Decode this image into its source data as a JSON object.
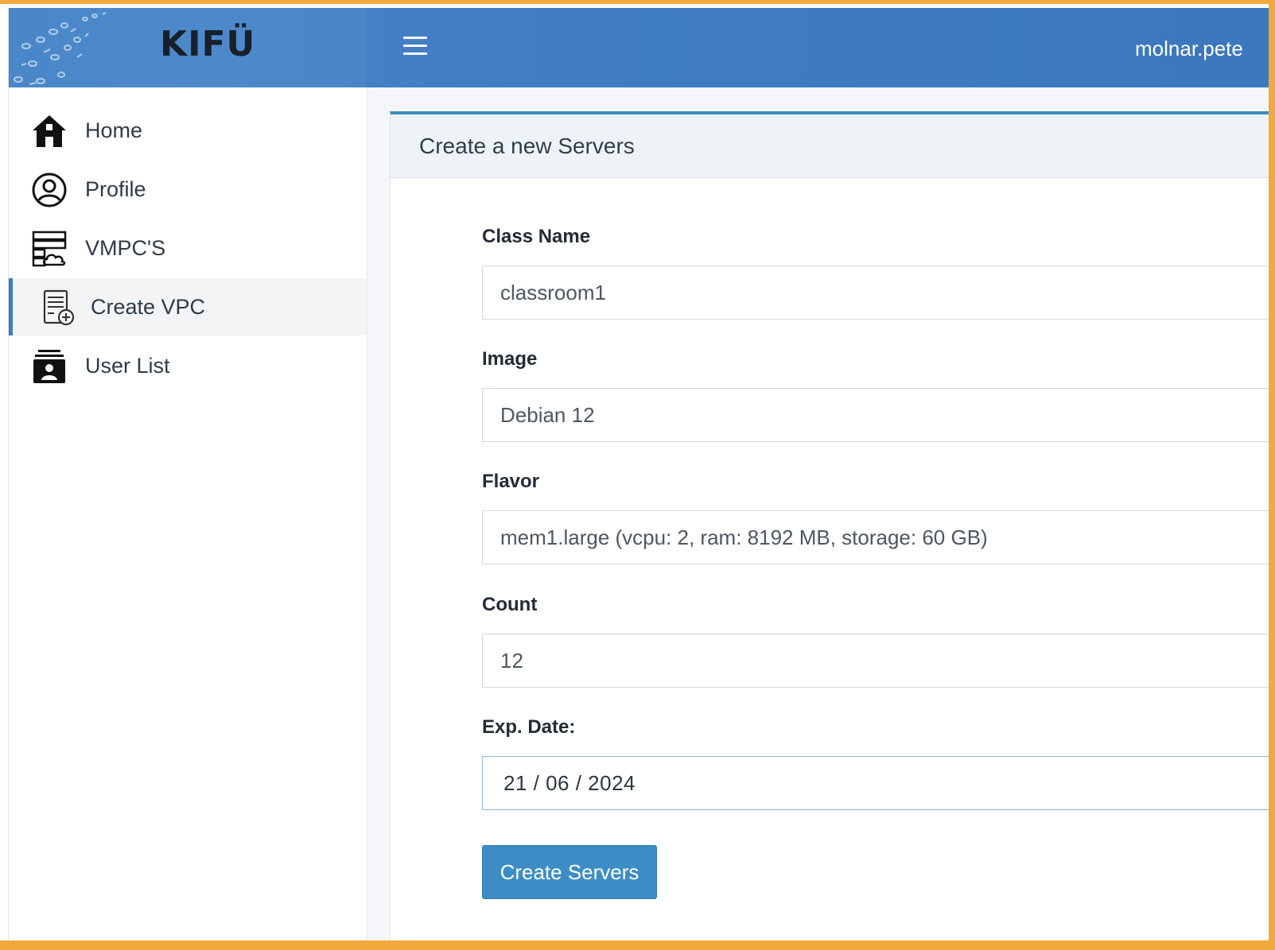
{
  "header": {
    "logo_text": "KIFÜ",
    "username": "molnar.pete"
  },
  "sidebar": {
    "items": [
      {
        "label": "Home",
        "icon": "home-icon"
      },
      {
        "label": "Profile",
        "icon": "user-circle-icon"
      },
      {
        "label": "VMPC'S",
        "icon": "server-cloud-icon"
      },
      {
        "label": "Create VPC",
        "icon": "server-add-icon",
        "active": true
      },
      {
        "label": "User List",
        "icon": "user-list-icon"
      }
    ]
  },
  "card": {
    "title": "Create a new Servers"
  },
  "form": {
    "class_name": {
      "label": "Class Name",
      "value": "classroom1"
    },
    "image": {
      "label": "Image",
      "value": "Debian 12"
    },
    "flavor": {
      "label": "Flavor",
      "value": "mem1.large (vcpu: 2, ram: 8192 MB, storage: 60 GB)"
    },
    "count": {
      "label": "Count",
      "value": "12"
    },
    "exp_date": {
      "label": "Exp. Date:",
      "value": "21 / 06 / 2024"
    },
    "submit_label": "Create Servers"
  },
  "colors": {
    "topbar": "#3f7cc2",
    "accent": "#3c8dbc",
    "button": "#3c8dc5",
    "frame": "#f2a93b"
  }
}
